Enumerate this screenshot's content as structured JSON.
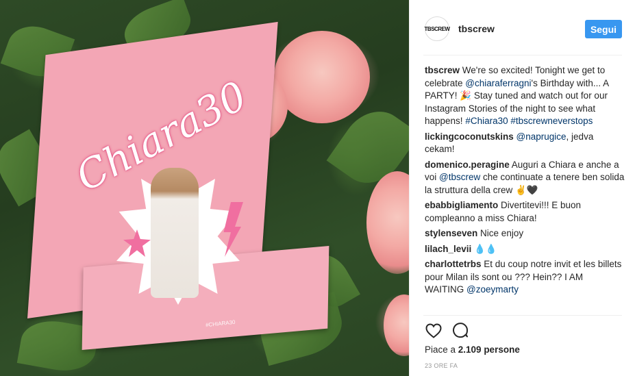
{
  "post": {
    "account": "tbscrew",
    "avatar_text": "TBSCREW",
    "follow_label": "Segui",
    "card_script_text": "Chiara30",
    "card_hashtag_text": "#CHIARA30"
  },
  "comments": [
    {
      "user": "tbscrew",
      "parts": [
        {
          "t": " We're so excited! Tonight we get to celebrate "
        },
        {
          "t": "@chiaraferragni",
          "link": true
        },
        {
          "t": "'s Birthday with... A PARTY! 🎉 Stay tuned and watch out for our Instagram Stories of the night to see what happens! "
        },
        {
          "t": "#Chiara30",
          "link": true
        },
        {
          "t": " "
        },
        {
          "t": "#tbscrewneverstops",
          "link": true
        }
      ]
    },
    {
      "user": "lickingcoconutskins",
      "parts": [
        {
          "t": " "
        },
        {
          "t": "@naprugice",
          "link": true
        },
        {
          "t": ", jedva cekam!"
        }
      ]
    },
    {
      "user": "domenico.peragine",
      "parts": [
        {
          "t": " Auguri a Chiara e anche a voi "
        },
        {
          "t": "@tbscrew",
          "link": true
        },
        {
          "t": " che continuate a tenere ben solida la struttura della crew ✌🖤"
        }
      ]
    },
    {
      "user": "ebabbigliamento",
      "parts": [
        {
          "t": " Divertitevi!!! E buon compleanno a miss Chiara!"
        }
      ]
    },
    {
      "user": "stylenseven",
      "parts": [
        {
          "t": " Nice enjoy"
        }
      ]
    },
    {
      "user": "lilach_levii",
      "parts": [
        {
          "t": " 💧💧"
        }
      ]
    },
    {
      "user": "charlottetrbs",
      "parts": [
        {
          "t": " Et du coup notre invit et les billets pour Milan ils sont ou ??? Hein?? I AM WAITING "
        },
        {
          "t": "@zoeymarty",
          "link": true
        }
      ]
    }
  ],
  "footer": {
    "likes_prefix": "Piace a ",
    "likes_count": "2.109 persone",
    "timestamp": "23 ORE FA"
  },
  "icons": [
    "heart-icon",
    "comment-icon"
  ],
  "colors": {
    "accent": "#3897f0",
    "link": "#003569"
  }
}
